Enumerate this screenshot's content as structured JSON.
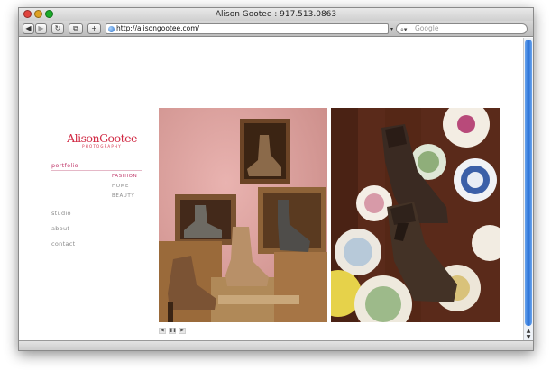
{
  "window": {
    "title": "Alison Gootee : 917.513.0863"
  },
  "toolbar": {
    "back_icon": "back-arrow-icon",
    "forward_icon": "forward-arrow-icon",
    "reload_icon": "reload-icon",
    "bookmark_icon": "bookmark-icon",
    "add_icon": "add-bookmark-icon",
    "url": "http://alisongootee.com/",
    "search_placeholder": "Google"
  },
  "site": {
    "logo_main": "AlisonGootee",
    "logo_sub": "PHOTOGRAPHY",
    "nav": [
      {
        "label": "portfolio",
        "active": true
      },
      {
        "label": "studio",
        "active": false
      },
      {
        "label": "about",
        "active": false
      },
      {
        "label": "contact",
        "active": false
      }
    ],
    "subnav": [
      {
        "label": "FASHION",
        "active": true
      },
      {
        "label": "HOME",
        "active": false
      },
      {
        "label": "BEAUTY",
        "active": false
      }
    ]
  },
  "slideshow": {
    "controls": [
      {
        "icon": "previous-icon"
      },
      {
        "icon": "pause-icon"
      },
      {
        "icon": "next-icon"
      }
    ]
  },
  "colors": {
    "accent": "#c0396b",
    "logo": "#d12a44",
    "nav_text": "#8a8a8a"
  }
}
